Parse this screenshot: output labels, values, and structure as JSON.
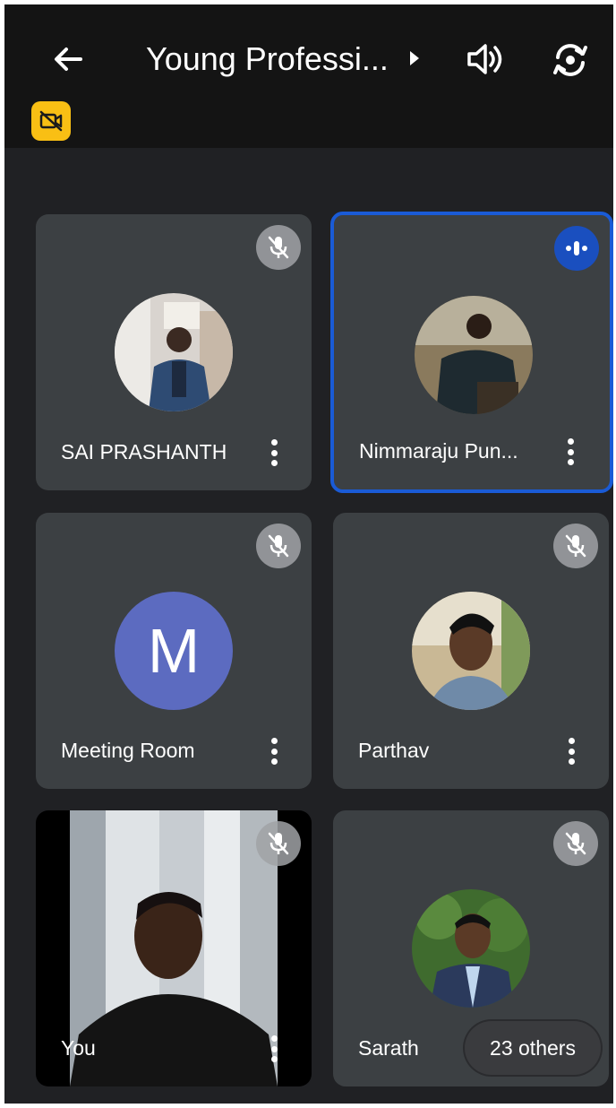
{
  "header": {
    "title": "Young Professi...",
    "icons": [
      "arrow-left-icon",
      "caret-right-icon",
      "speaker-icon",
      "camera-switch-icon",
      "video-off-icon"
    ]
  },
  "participants": [
    {
      "name": "SAI PRASHANTH",
      "muted": true,
      "avatar": "photo"
    },
    {
      "name": "Nimmaraju Pun...",
      "muted": false,
      "speaking": true,
      "avatar": "photo"
    },
    {
      "name": "Meeting Room",
      "muted": true,
      "avatar": "letter",
      "letter": "M"
    },
    {
      "name": "Parthav",
      "muted": true,
      "avatar": "photo"
    },
    {
      "name": "You",
      "muted": true,
      "avatar": "video"
    },
    {
      "name": "Sarath",
      "muted": true,
      "avatar": "photo"
    }
  ],
  "others": {
    "label": "23 others"
  },
  "colors": {
    "background": "#202124",
    "tile": "#3c4043",
    "speaking": "#1a5bd6",
    "badge": "#f9bf14",
    "letter_avatar": "#5c6bc0"
  }
}
